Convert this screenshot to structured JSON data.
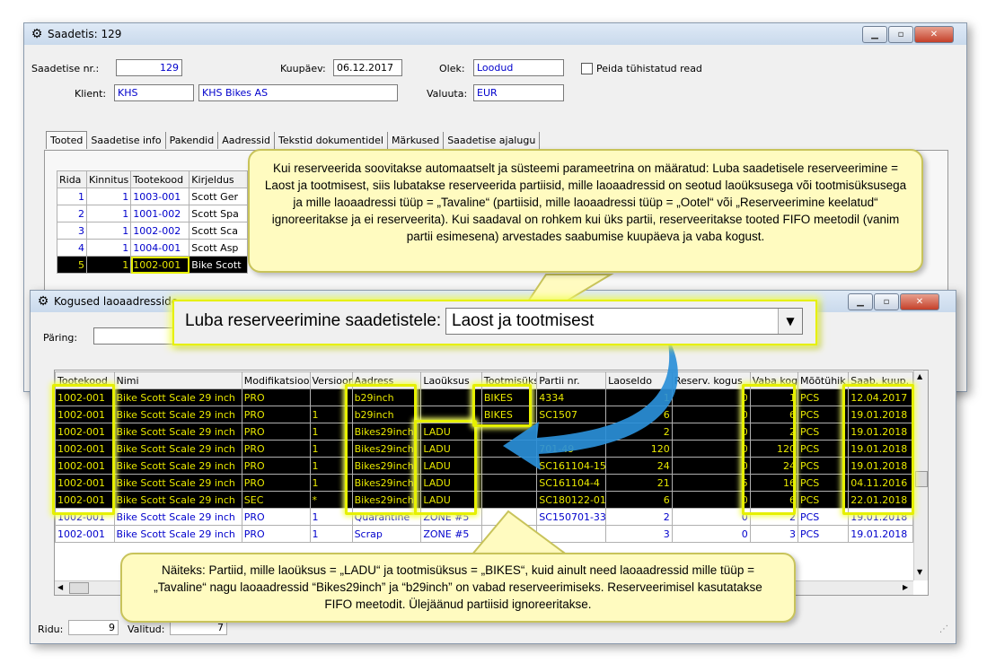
{
  "main_window": {
    "title": "Saadetis: 129",
    "shipment_no_label": "Saadetise nr.:",
    "shipment_no": "129",
    "date_label": "Kuupäev:",
    "date": "06.12.2017",
    "status_label": "Olek:",
    "status": "Loodud",
    "hide_cancelled_label": "Peida tühistatud read",
    "client_label": "Klient:",
    "client_code": "KHS",
    "client_name": "KHS Bikes AS",
    "currency_label": "Valuuta:",
    "currency": "EUR",
    "tabs": [
      "Tooted",
      "Saadetise info",
      "Pakendid",
      "Aadressid",
      "Tekstid dokumentidel",
      "Märkused",
      "Saadetise ajalugu"
    ],
    "product_headers": [
      "Rida",
      "Kinnitus",
      "Tootekood",
      "Kirjeldus"
    ],
    "product_rows": [
      {
        "rida": "1",
        "kinnitus": "1",
        "tootekood": "1003-001",
        "kirjeldus": "Scott Ger"
      },
      {
        "rida": "2",
        "kinnitus": "1",
        "tootekood": "1001-002",
        "kirjeldus": "Scott Spa"
      },
      {
        "rida": "3",
        "kinnitus": "1",
        "tootekood": "1002-002",
        "kirjeldus": "Scott Sca"
      },
      {
        "rida": "4",
        "kinnitus": "1",
        "tootekood": "1004-001",
        "kirjeldus": "Scott Asp"
      },
      {
        "rida": "5",
        "kinnitus": "1",
        "tootekood": "1002-001",
        "kirjeldus": "Bike Scott"
      }
    ]
  },
  "stock_window": {
    "title": "Kogused laoaadresside",
    "query_label": "Päring:",
    "headers": [
      "Tootekood",
      "Nimi",
      "Modifikatsioo",
      "Versioon",
      "Aadress",
      "Laoüksus",
      "Tootmisüks",
      "Partii nr.",
      "Laoseldo",
      "Reserv. kogus",
      "Vaba kogu",
      "Mõõtühik",
      "Saab. kuup."
    ],
    "rows": [
      {
        "kood": "1002-001",
        "nimi": "Bike Scott Scale 29 inch",
        "mod": "PRO",
        "ver": "",
        "aadress": "b29inch",
        "laoyksus": "",
        "tootmis": "BIKES",
        "partii": "4334",
        "saldo": "1",
        "reserv": "0",
        "vaba": "1",
        "yhik": "PCS",
        "kuup": "12.04.2017",
        "style": "black"
      },
      {
        "kood": "1002-001",
        "nimi": "Bike Scott Scale 29 inch",
        "mod": "PRO",
        "ver": "1",
        "aadress": "b29inch",
        "laoyksus": "",
        "tootmis": "BIKES",
        "partii": "SC1507",
        "saldo": "6",
        "reserv": "0",
        "vaba": "6",
        "yhik": "PCS",
        "kuup": "19.01.2018",
        "style": "black"
      },
      {
        "kood": "1002-001",
        "nimi": "Bike Scott Scale 29 inch",
        "mod": "PRO",
        "ver": "1",
        "aadress": "Bikes29inch",
        "laoyksus": "LADU",
        "tootmis": "",
        "partii": "",
        "saldo": "2",
        "reserv": "0",
        "vaba": "2",
        "yhik": "PCS",
        "kuup": "19.01.2018",
        "style": "black"
      },
      {
        "kood": "1002-001",
        "nimi": "Bike Scott Scale 29 inch",
        "mod": "PRO",
        "ver": "1",
        "aadress": "Bikes29inch",
        "laoyksus": "LADU",
        "tootmis": "",
        "partii": "701-49",
        "saldo": "120",
        "reserv": "0",
        "vaba": "120",
        "yhik": "PCS",
        "kuup": "19.01.2018",
        "style": "black"
      },
      {
        "kood": "1002-001",
        "nimi": "Bike Scott Scale 29 inch",
        "mod": "PRO",
        "ver": "1",
        "aadress": "Bikes29inch",
        "laoyksus": "LADU",
        "tootmis": "",
        "partii": "SC161104-15",
        "saldo": "24",
        "reserv": "0",
        "vaba": "24",
        "yhik": "PCS",
        "kuup": "19.01.2018",
        "style": "black"
      },
      {
        "kood": "1002-001",
        "nimi": "Bike Scott Scale 29 inch",
        "mod": "PRO",
        "ver": "1",
        "aadress": "Bikes29inch",
        "laoyksus": "LADU",
        "tootmis": "",
        "partii": "SC161104-4",
        "saldo": "21",
        "reserv": "5",
        "vaba": "16",
        "yhik": "PCS",
        "kuup": "04.11.2016",
        "style": "black"
      },
      {
        "kood": "1002-001",
        "nimi": "Bike Scott Scale 29 inch",
        "mod": "SEC",
        "ver": "*",
        "aadress": "Bikes29inch",
        "laoyksus": "LADU",
        "tootmis": "",
        "partii": "SC180122-01",
        "saldo": "6",
        "reserv": "0",
        "vaba": "6",
        "yhik": "PCS",
        "kuup": "22.01.2018",
        "style": "black"
      },
      {
        "kood": "1002-001",
        "nimi": "Bike Scott Scale 29 inch",
        "mod": "PRO",
        "ver": "1",
        "aadress": "Quarantine",
        "laoyksus": "ZONE #5",
        "tootmis": "",
        "partii": "SC150701-33",
        "saldo": "2",
        "reserv": "0",
        "vaba": "2",
        "yhik": "PCS",
        "kuup": "19.01.2018",
        "style": "blue"
      },
      {
        "kood": "1002-001",
        "nimi": "Bike Scott Scale 29 inch",
        "mod": "PRO",
        "ver": "1",
        "aadress": "Scrap",
        "laoyksus": "ZONE #5",
        "tootmis": "",
        "partii": "",
        "saldo": "3",
        "reserv": "0",
        "vaba": "3",
        "yhik": "PCS",
        "kuup": "19.01.2018",
        "style": "blue"
      }
    ],
    "footer_rows_label": "Ridu:",
    "footer_rows": "9",
    "footer_selected_label": "Valitud:",
    "footer_selected": "7"
  },
  "zoom_setting": {
    "label": "Luba reserveerimine saadetistele:",
    "value": "Laost ja tootmisest"
  },
  "callout_top": "Kui reserveerida soovitakse automaatselt ja süsteemi parameetrina on määratud: Luba saadetisele reserveerimine = Laost ja tootmisest, siis lubatakse reserveerida partiisid, mille laoaadressid on seotud laoüksusega või tootmisüksusega ja mille laoaadressi tüüp = „Tavaline“ (partiisid, mille laoaadressi tüüp = „Ootel“ või „Reserveerimine keelatud“ ignoreeritakse ja ei reserveerita). Kui saadaval on rohkem kui üks partii, reserveeritakse tooted FIFO meetodil (vanim partii esimesena) arvestades saabumise kuupäeva ja vaba kogust.",
  "callout_bottom": "Näiteks: Partiid, mille laoüksus = „LADU“ ja tootmisüksus = „BIKES“, kuid ainult need laoaadressid mille tüüp = „Tavaline“ nagu laoaadressid “Bikes29inch” ja “b29inch” on vabad reserveerimiseks. Reserveerimisel kasutatakse FIFO meetodit. Ülejäänud partiisid ignoreeritakse.",
  "colors": {
    "highlight": "#e6f000",
    "callout_bg": "#fffbc0",
    "link_blue": "#0000cc",
    "arrow": "#2a8fd8"
  },
  "icons": [
    "app-gear-icon",
    "minimize-icon",
    "maximize-icon",
    "close-icon",
    "dropdown-arrow-icon",
    "scroll-up-icon",
    "scroll-down-icon",
    "scroll-left-icon",
    "scroll-right-icon",
    "resize-grip-icon"
  ]
}
